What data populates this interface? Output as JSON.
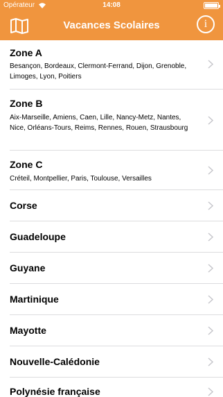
{
  "status_bar": {
    "carrier": "Opérateur",
    "time": "14:08"
  },
  "nav": {
    "title": "Vacances Scolaires",
    "info_label": "i"
  },
  "zones": [
    {
      "title": "Zone A",
      "subtitle": "Besançon, Bordeaux, Clermont-Ferrand, Dijon, Grenoble, Limoges, Lyon, Poitiers"
    },
    {
      "title": "Zone B",
      "subtitle": "Aix-Marseille, Amiens, Caen, Lille, Nancy-Metz, Nantes, Nice, Orléans-Tours, Reims, Rennes, Rouen, Strausbourg"
    },
    {
      "title": "Zone C",
      "subtitle": "Créteil, Montpellier, Paris, Toulouse, Versailles"
    },
    {
      "title": "Corse"
    },
    {
      "title": "Guadeloupe"
    },
    {
      "title": "Guyane"
    },
    {
      "title": "Martinique"
    },
    {
      "title": "Mayotte"
    },
    {
      "title": "Nouvelle-Calédonie"
    },
    {
      "title": "Polynésie française"
    }
  ]
}
